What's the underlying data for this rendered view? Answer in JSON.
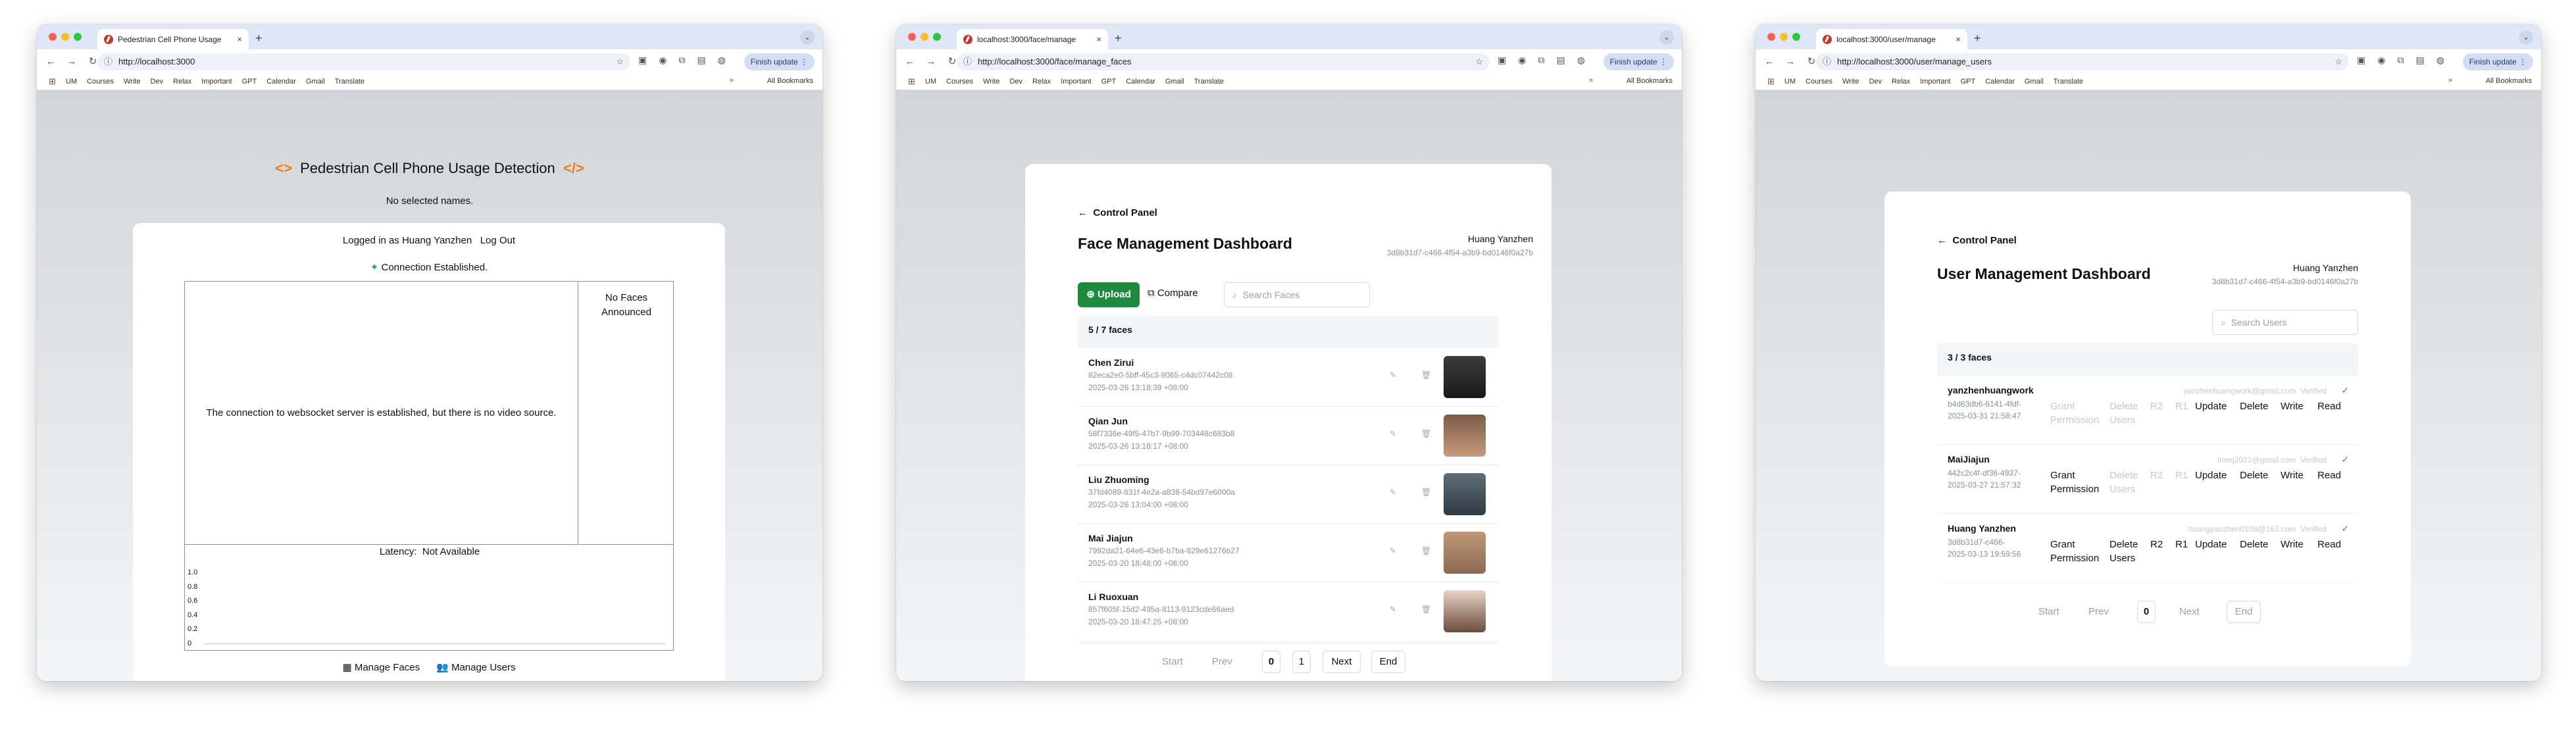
{
  "browser": {
    "bookmarks": [
      "UM",
      "Courses",
      "Write",
      "Dev",
      "Relax",
      "Important",
      "GPT",
      "Calendar",
      "Gmail",
      "Translate"
    ],
    "all_bookmarks": "All Bookmarks",
    "update": "Finish update",
    "tab_close": "×",
    "new_tab": "+"
  },
  "w1": {
    "tab_title": "Pedestrian Cell Phone Usage",
    "url": "http://localhost:3000",
    "title": "Pedestrian Cell Phone Usage Detection",
    "title_left": "<>",
    "title_right": "</>",
    "subtitle": "No selected names.",
    "logged_in": "Logged in as Huang Yanzhen",
    "logout": "Log Out",
    "connection": "Connection Established.",
    "video_msg": "The connection to websocket server is established, but there is no video source.",
    "faces_msg": "No Faces Announced",
    "latency_label": "Latency:",
    "latency_value": "Not Available",
    "yticks": [
      "1.0",
      "0.8",
      "0.6",
      "0.4",
      "0.2",
      "0"
    ],
    "manage_faces": "Manage Faces",
    "manage_users": "Manage Users"
  },
  "w2": {
    "tab_title": "localhost:3000/face/manage",
    "url": "http://localhost:3000/face/manage_faces",
    "back": "Control Panel",
    "title": "Face Management Dashboard",
    "user_name": "Huang Yanzhen",
    "user_id": "3d8b31d7-c466-4f54-a3b9-bd0146f0a27b",
    "upload": "Upload",
    "compare": "Compare",
    "search_placeholder": "Search Faces",
    "count": "5 / 7 faces",
    "faces": [
      {
        "name": "Chen Zirui",
        "id": "82eca2e0-5bff-45c3-9065-c4dc07442c08",
        "time": "2025-03-26 13:18:39 +08:00"
      },
      {
        "name": "Qian Jun",
        "id": "58f7336e-49f5-47b7-9b99-703448c683b8",
        "time": "2025-03-26 13:18:17 +08:00"
      },
      {
        "name": "Liu Zhuoming",
        "id": "37fd4089-831f-4e2a-a838-54bd97e6000a",
        "time": "2025-03-26 13:04:00 +08:00"
      },
      {
        "name": "Mai Jiajun",
        "id": "7992da21-64e6-43e6-b7ba-829e61276b27",
        "time": "2025-03-20 18:48:00 +08:00"
      },
      {
        "name": "Li Ruoxuan",
        "id": "857f605f-15d2-495a-8113-9123cde66aed",
        "time": "2025-03-20 18:47:25 +08:00"
      }
    ],
    "pager": {
      "start": "Start",
      "prev": "Prev",
      "p0": "0",
      "p1": "1",
      "next": "Next",
      "end": "End"
    }
  },
  "w3": {
    "tab_title": "localhost:3000/user/manage",
    "url": "http://localhost:3000/user/manage_users",
    "back": "Control Panel",
    "title": "User Management Dashboard",
    "user_name": "Huang Yanzhen",
    "user_id": "3d8b31d7-c466-4f54-a3b9-bd0146f0a27b",
    "search_placeholder": "Search Users",
    "count": "3 / 3 faces",
    "users": [
      {
        "name": "yanzhenhuangwork",
        "id": "b4d63db6-6141-4fdf-",
        "time": "2025-03-31 21:58:47",
        "email": "yanzhenhuangwork@gmail.com",
        "verified": "Verified"
      },
      {
        "name": "MaiJiajun",
        "id": "442c2c4f-df36-4937-",
        "time": "2025-03-27 21:57:32",
        "email": "lmmj2021@gmail.com",
        "verified": "Verified"
      },
      {
        "name": "Huang Yanzhen",
        "id": "3d8b31d7-c466-",
        "time": "2025-03-13 19:59:56",
        "email": "huangyanzhen0108@163.com",
        "verified": "Verified"
      }
    ],
    "perms": {
      "grant": "Grant Permission",
      "delete": "Delete Users",
      "r2": "R2",
      "r1": "R1",
      "update": "Update",
      "del": "Delete",
      "write": "Write",
      "read": "Read"
    },
    "pager": {
      "start": "Start",
      "prev": "Prev",
      "p0": "0",
      "next": "Next",
      "end": "End"
    }
  }
}
